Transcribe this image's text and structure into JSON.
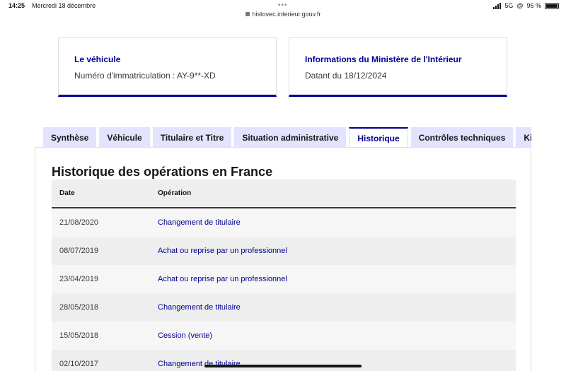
{
  "status_bar": {
    "time": "14:25",
    "date": "Mercredi 18 décembre",
    "url": "histovec.interieur.gouv.fr",
    "network": "5G",
    "battery_text": "96 %"
  },
  "cards": {
    "vehicle": {
      "title": "Le véhicule",
      "text": "Numéro d'immatriculation : AY-9**-XD"
    },
    "ministry": {
      "title": "Informations du Ministère de l'Intérieur",
      "text": "Datant du 18/12/2024"
    }
  },
  "tabs": [
    {
      "label": "Synthèse"
    },
    {
      "label": "Véhicule"
    },
    {
      "label": "Titulaire et Titre"
    },
    {
      "label": "Situation administrative"
    },
    {
      "label": "Historique",
      "active": true
    },
    {
      "label": "Contrôles techniques"
    },
    {
      "label": "Kilo"
    }
  ],
  "history": {
    "title": "Historique des opérations en France",
    "columns": {
      "date": "Date",
      "operation": "Opération"
    },
    "rows": [
      {
        "date": "21/08/2020",
        "operation": "Changement de titulaire"
      },
      {
        "date": "08/07/2019",
        "operation": "Achat ou reprise par un professionnel"
      },
      {
        "date": "23/04/2019",
        "operation": "Achat ou reprise par un professionnel"
      },
      {
        "date": "28/05/2018",
        "operation": "Changement de titulaire"
      },
      {
        "date": "15/05/2018",
        "operation": "Cession (vente)"
      },
      {
        "date": "02/10/2017",
        "operation": "Changement de titulaire"
      }
    ]
  },
  "colors": {
    "accent": "#000091",
    "tab_background": "#e3e3fd",
    "row_alt": "#eeeeee"
  }
}
